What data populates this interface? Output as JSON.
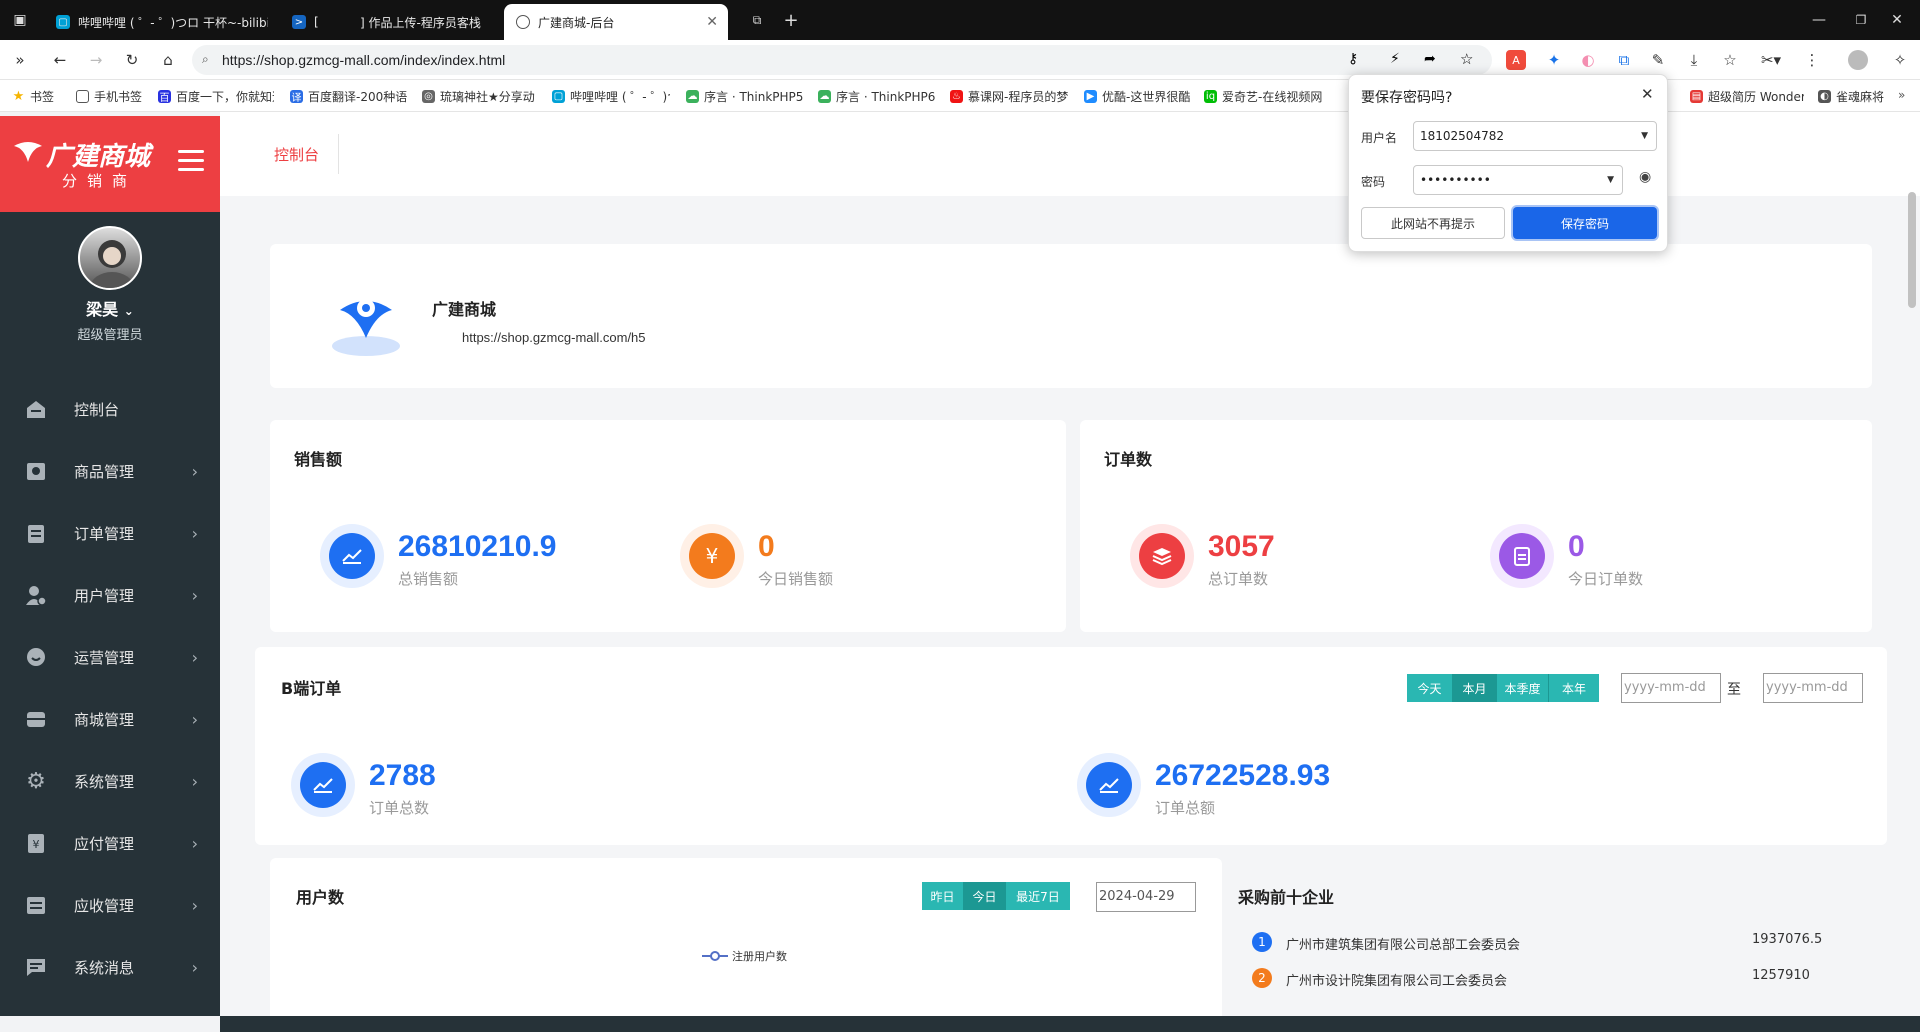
{
  "tabs": [
    {
      "label": "哔哩哔哩 ( ゜- ゜)つロ 干杯~-bilibili",
      "fav_color": "#00a1d6"
    },
    {
      "label": "[",
      "fav_color": "#1565c0"
    },
    {
      "label": "] 作品上传-程序员客栈",
      "fav_color": ""
    },
    {
      "label": "广建商城-后台",
      "fav_color": "#666",
      "active": true
    }
  ],
  "address": {
    "url": "https://shop.gzmcg-mall.com/index/index.html"
  },
  "bookmarks": [
    {
      "label": "书签",
      "color": "#f5b400"
    },
    {
      "label": "手机书签",
      "color": "#555"
    },
    {
      "label": "百度一下，你就知道",
      "color": "#2932e1"
    },
    {
      "label": "百度翻译-200种语",
      "color": "#2b6de5"
    },
    {
      "label": "琉璃神社★分享动",
      "color": "#666"
    },
    {
      "label": "哔哩哔哩 ( ゜- ゜)つ",
      "color": "#00a1d6"
    },
    {
      "label": "序言 · ThinkPHP5",
      "color": "#3bb15c"
    },
    {
      "label": "序言 · ThinkPHP6",
      "color": "#3bb15c"
    },
    {
      "label": "慕课网-程序员的梦",
      "color": "#f01414"
    },
    {
      "label": "优酷-这世界很酷",
      "color": "#1f8cff"
    },
    {
      "label": "爱奇艺-在线视频网",
      "color": "#00be06"
    },
    {
      "label": "超级简历 Wonder",
      "color": "#e53935"
    },
    {
      "label": "雀魂麻将",
      "color": "#555"
    }
  ],
  "sidebar": {
    "logo_text": "广建商城",
    "logo_sub": "分销商",
    "user_name": "梁昊",
    "user_role": "超级管理员",
    "menu": [
      {
        "label": "控制台",
        "icon": "home-icon"
      },
      {
        "label": "商品管理",
        "icon": "bag-icon"
      },
      {
        "label": "订单管理",
        "icon": "clipboard-icon"
      },
      {
        "label": "用户管理",
        "icon": "user-icon"
      },
      {
        "label": "运营管理",
        "icon": "face-icon"
      },
      {
        "label": "商城管理",
        "icon": "store-icon"
      },
      {
        "label": "系统管理",
        "icon": "gear-icon"
      },
      {
        "label": "应付管理",
        "icon": "payable-icon"
      },
      {
        "label": "应收管理",
        "icon": "sliders-icon"
      },
      {
        "label": "系统消息",
        "icon": "message-icon"
      }
    ]
  },
  "header": {
    "breadcrumb": "控制台"
  },
  "shop": {
    "name": "广建商城",
    "url": "https://shop.gzmcg-mall.com/h5"
  },
  "sales": {
    "title": "销售额",
    "total_value": "26810210.9",
    "total_label": "总销售额",
    "today_value": "0",
    "today_label": "今日销售额"
  },
  "orders": {
    "title": "订单数",
    "total_value": "3057",
    "total_label": "总订单数",
    "today_value": "0",
    "today_label": "今日订单数"
  },
  "b_orders": {
    "title": "B端订单",
    "ranges": [
      "今天",
      "本月",
      "本季度",
      "本年"
    ],
    "date_placeholder": "yyyy-mm-dd",
    "to": "至",
    "count_value": "2788",
    "count_label": "订单总数",
    "amount_value": "26722528.93",
    "amount_label": "订单总额"
  },
  "users": {
    "title": "用户数",
    "ranges": [
      "昨日",
      "今日",
      "最近7日"
    ],
    "date": "2024-04-29",
    "legend": "注册用户数"
  },
  "top_companies": {
    "title": "采购前十企业",
    "items": [
      {
        "rank": "1",
        "name": "广州市建筑集团有限公司总部工会委员会",
        "value": "1937076.5",
        "color": "#1e6ff2"
      },
      {
        "rank": "2",
        "name": "广州市设计院集团有限公司工会委员会",
        "value": "1257910",
        "color": "#f37b1d"
      }
    ]
  },
  "password_popup": {
    "title": "要保存密码吗?",
    "username_label": "用户名",
    "username": "18102504782",
    "password_label": "密码",
    "password": "••••••••••",
    "never_label": "此网站不再提示",
    "save_label": "保存密码"
  }
}
